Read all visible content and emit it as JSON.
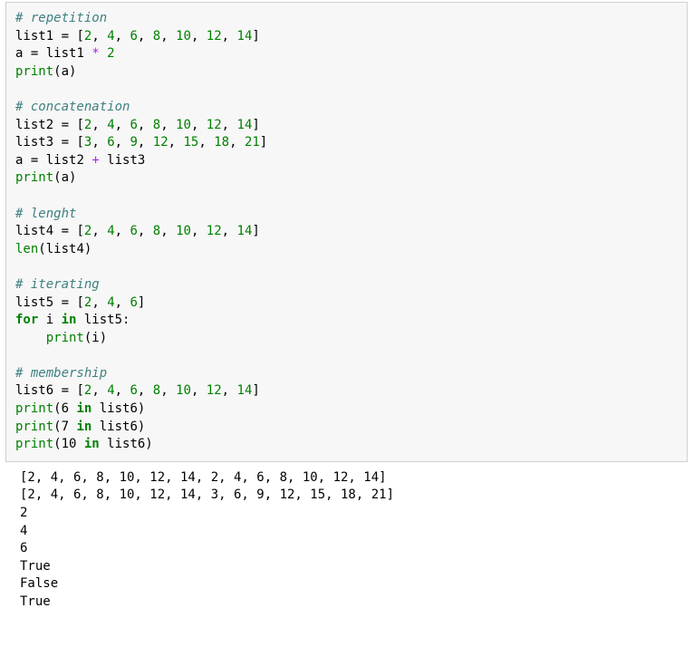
{
  "chart_data": {
    "type": "table",
    "title": "Python list operations code example with output",
    "sections": [
      {
        "name": "repetition",
        "code": [
          "list1 = [2, 4, 6, 8, 10, 12, 14]",
          "a = list1 * 2",
          "print(a)"
        ]
      },
      {
        "name": "concatenation",
        "code": [
          "list2 = [2, 4, 6, 8, 10, 12, 14]",
          "list3 = [3, 6, 9, 12, 15, 18, 21]",
          "a = list2 + list3",
          "print(a)"
        ]
      },
      {
        "name": "lenght",
        "code": [
          "list4 = [2, 4, 6, 8, 10, 12, 14]",
          "len(list4)"
        ]
      },
      {
        "name": "iterating",
        "code": [
          "list5 = [2, 4, 6]",
          "for i in list5:",
          "    print(i)"
        ]
      },
      {
        "name": "membership",
        "code": [
          "list6 = [2, 4, 6, 8, 10, 12, 14]",
          "print(6 in list6)",
          "print(7 in list6)",
          "print(10 in list6)"
        ]
      }
    ],
    "outputs": [
      "[2, 4, 6, 8, 10, 12, 14, 2, 4, 6, 8, 10, 12, 14]",
      "[2, 4, 6, 8, 10, 12, 14, 3, 6, 9, 12, 15, 18, 21]",
      "2",
      "4",
      "6",
      "True",
      "False",
      "True"
    ]
  },
  "code": {
    "c1": "# repetition",
    "l1a": "list1",
    "eq": " = ",
    "list_2_14": "[2, 4, 6, 8, 10, 12, 14]",
    "l1b_a": "a",
    "l1b_rest": "list1 ",
    "star": "*",
    "l1b_two": " 2",
    "print_open": "print",
    "pa": "(a)",
    "c2": "# concatenation",
    "l2a": "list2",
    "l3a": "list3",
    "list_3_21": "[3, 6, 9, 12, 15, 18, 21]",
    "l2plus_a": "a",
    "l2plus_rest": "list2 ",
    "plus": "+",
    "l2plus_end": " list3",
    "c3": "# lenght",
    "l4a": "list4",
    "len": "len",
    "len_arg": "(list4)",
    "c4": "# iterating",
    "l5a": "list5",
    "list_246": "[2, 4, 6]",
    "for": "for",
    "for_i": " i ",
    "in": "in",
    "for_end": " list5:",
    "indent_print": "    print",
    "print_i": "(i)",
    "c5": "# membership",
    "l6a": "list6",
    "print6": "(6 ",
    "print6_end": " list6)",
    "print7": "(7 ",
    "print10": "(10 ",
    "n2": "2",
    "n4": "4",
    "n6": "6",
    "n8": "8",
    "n10": "10",
    "n12": "12",
    "n14": "14",
    "n3": "3",
    "n9": "9",
    "n15": "15",
    "n18": "18",
    "n21": "21",
    "lb": "[",
    "rb": "]",
    "comma": ", "
  },
  "output": {
    "o1": "[2, 4, 6, 8, 10, 12, 14, 2, 4, 6, 8, 10, 12, 14]",
    "o2": "[2, 4, 6, 8, 10, 12, 14, 3, 6, 9, 12, 15, 18, 21]",
    "o3": "2",
    "o4": "4",
    "o5": "6",
    "o6": "True",
    "o7": "False",
    "o8": "True"
  }
}
